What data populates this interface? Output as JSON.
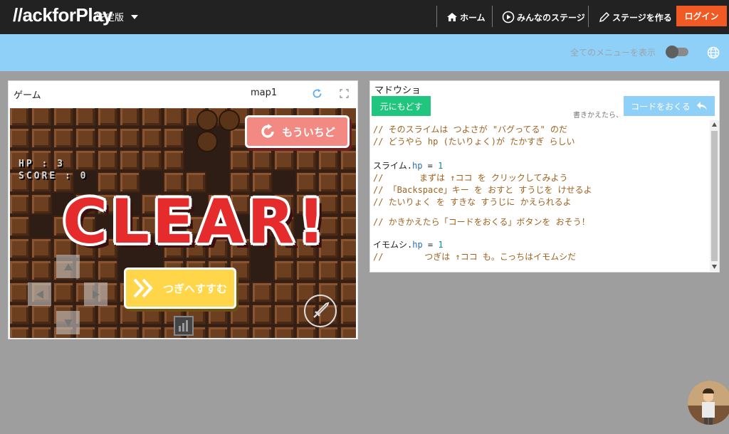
{
  "header": {
    "logo": "//ackforPĺay",
    "version": "安定版",
    "nav": {
      "home": "ホーム",
      "stages": "みんなのステージ",
      "create": "ステージを作る",
      "login": "ログイン"
    }
  },
  "subbar": {
    "show_all_menu": "全てのメニューを表示"
  },
  "game": {
    "title": "ゲーム",
    "map": "map1",
    "hud_hp": "HP : 3",
    "hud_score": "SCORE : 0",
    "clear": "CLEAR!",
    "retry": "もういちど",
    "next": "つぎへすすむ"
  },
  "editor": {
    "title": "マドウショ",
    "restore": "元にもどす",
    "hint": "書きかえたら、",
    "send": "コードをおくる",
    "lines": [
      "// そのスライムは つよさが \"バグってる\" のだ",
      "// どうやら hp (たいりょく)が たかすぎ らしい",
      "",
      "スライム.hp = 1",
      "//       まずは ↑ココ を クリックしてみよう",
      "// 「Backspace」キー を おすと すうじを けせるよ",
      "// たいりょく を すきな すうじに かえられるよ",
      "",
      "// かきかえたら「コードをおくる」ボタンを おそう！",
      "",
      "イモムシ.hp = 1",
      "//        つぎは ↑ココ も。こっちはイモムシだ"
    ],
    "code": {
      "l3_obj": "スライム",
      "l3_prop": "hp",
      "l3_val": "1",
      "l10_obj": "イモムシ",
      "l10_prop": "hp",
      "l10_val": "1"
    }
  },
  "colors": {
    "navbar": "#222222",
    "subbar": "#8fd0f9",
    "login": "#f15a24",
    "restore": "#20c580",
    "clear_red": "#e52b2b"
  }
}
